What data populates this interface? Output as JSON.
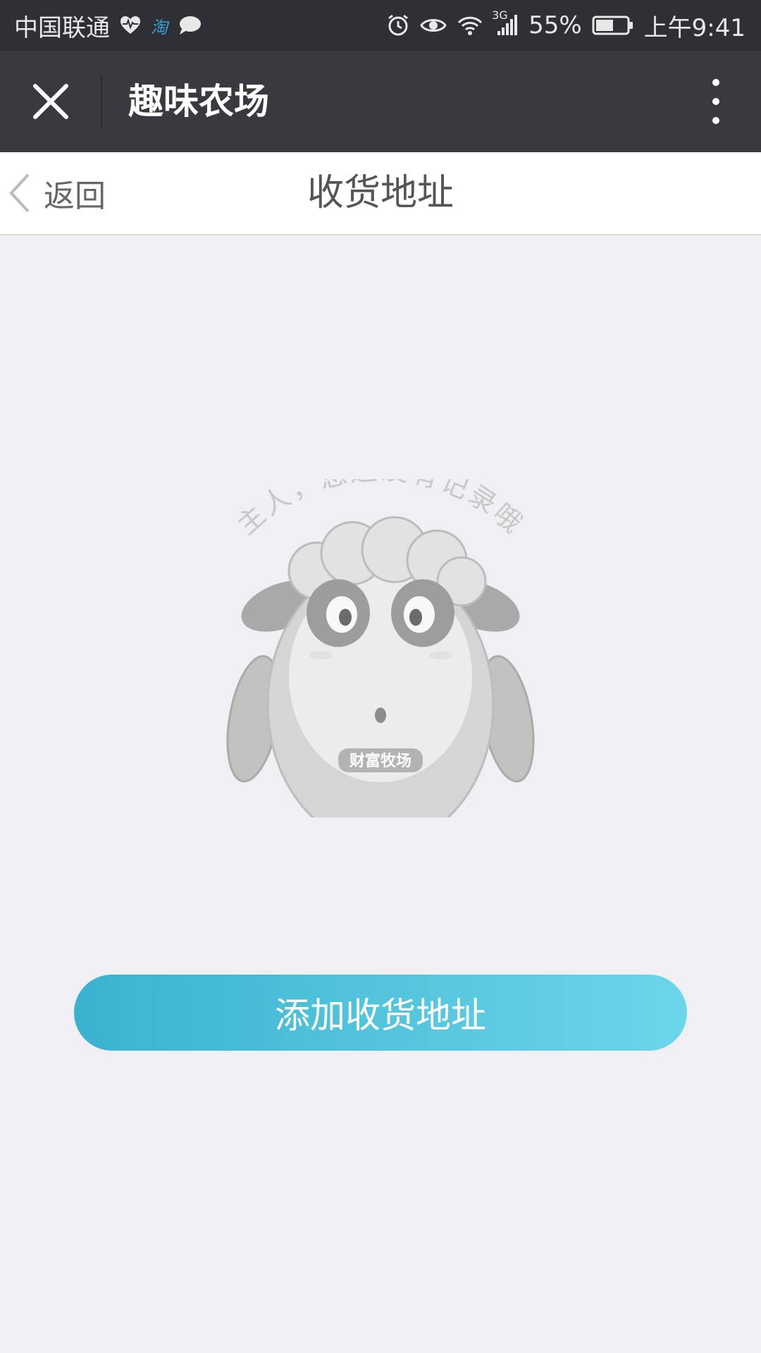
{
  "status_bar": {
    "carrier": "中国联通",
    "network": "3G",
    "battery": "55%",
    "time": "上午9:41",
    "icons": [
      "heart-rate-icon",
      "taobao-icon",
      "chat-bubble-icon",
      "alarm-icon",
      "eye-icon",
      "wifi-icon",
      "signal-icon",
      "battery-icon"
    ],
    "taobao_glyph": "淘"
  },
  "title_bar": {
    "title": "趣味农场",
    "close_icon": "close-icon",
    "more_icon": "more-vertical-icon"
  },
  "nav_bar": {
    "back_label": "返回",
    "title": "收货地址"
  },
  "empty_state": {
    "message": "主人，您还没有记录哦",
    "mascot_badge": "财富牧场"
  },
  "primary_action": {
    "label": "添加收货地址",
    "gradient_start": "#3ab2cf",
    "gradient_end": "#6cd6ea"
  }
}
